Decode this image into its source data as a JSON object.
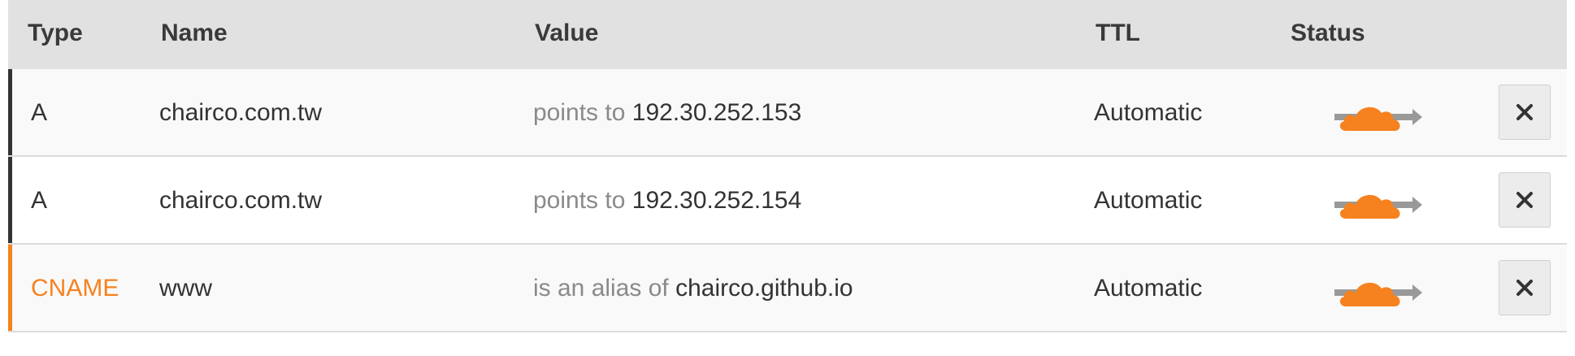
{
  "header": {
    "type": "Type",
    "name": "Name",
    "value": "Value",
    "ttl": "TTL",
    "status": "Status"
  },
  "rows": [
    {
      "type": "A",
      "name": "chairco.com.tw",
      "value_prefix": "points to",
      "value": "192.30.252.153",
      "ttl": "Automatic",
      "status_icon": "cloudflare-proxied-cloud-icon",
      "delete_icon": "close-icon"
    },
    {
      "type": "A",
      "name": "chairco.com.tw",
      "value_prefix": "points to",
      "value": "192.30.252.154",
      "ttl": "Automatic",
      "status_icon": "cloudflare-proxied-cloud-icon",
      "delete_icon": "close-icon"
    },
    {
      "type": "CNAME",
      "name": "www",
      "value_prefix": "is an alias of",
      "value": "chairco.github.io",
      "ttl": "Automatic",
      "status_icon": "cloudflare-proxied-cloud-icon",
      "delete_icon": "close-icon"
    }
  ],
  "colors": {
    "a_record_bar": "#333333",
    "cname_bar": "#f6821f",
    "cname_text": "#f6821f",
    "cloud": "#f6821f",
    "arrow": "#999999",
    "header_bg": "#e1e1e1",
    "row_alt_bg": "#f9f9f9"
  }
}
